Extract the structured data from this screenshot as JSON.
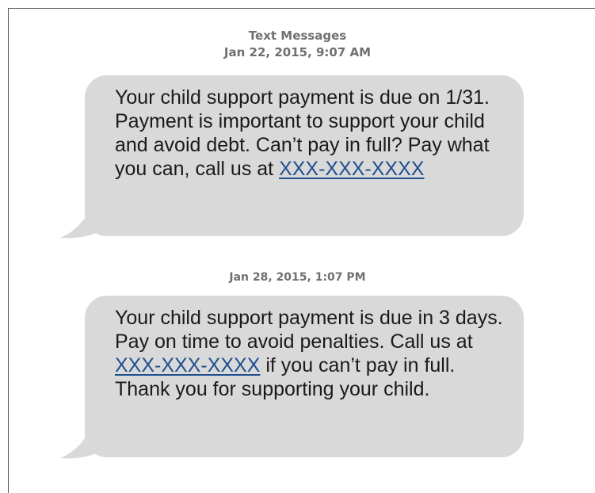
{
  "header": {
    "title": "Text Messages",
    "first_timestamp": "Jan 22, 2015, 9:07 AM"
  },
  "messages": [
    {
      "text": "Your child support payment is due on 1/31. Payment is important to support your child and avoid debt. Can’t pay in full? Pay what you can, call us at ",
      "link": "XXX-XXX-XXXX",
      "text_after": ""
    },
    {
      "timestamp": "Jan 28, 2015, 1:07 PM",
      "text": "Your child support payment is due in 3 days. Pay on time to avoid penalties. Call us at ",
      "link": "XXX-XXX-XXXX",
      "text_after": " if you can’t pay in full. Thank you for supporting your child."
    }
  ],
  "colors": {
    "bubble": "#d9d9d9",
    "link": "#1f4f8f",
    "timestamp": "#707070"
  }
}
